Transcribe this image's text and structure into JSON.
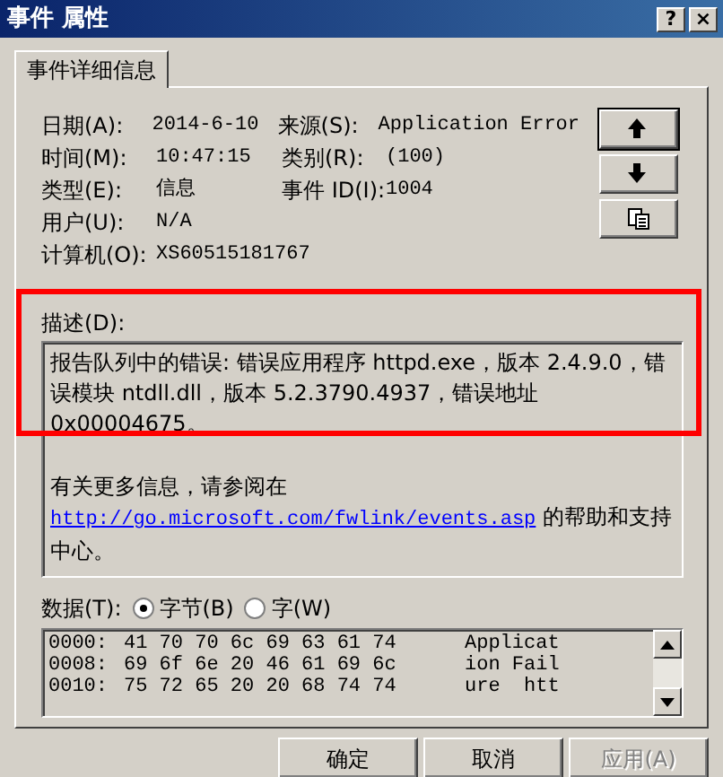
{
  "window": {
    "title": "事件 属性",
    "controls": [
      {
        "kind": "help",
        "label": "?"
      },
      {
        "kind": "close",
        "label": "×"
      }
    ]
  },
  "tabs": [
    {
      "label": "事件详细信息",
      "selected": true
    }
  ],
  "fields": [
    {
      "label": "日期(A):",
      "value": "2014-6-10",
      "label2": "来源(S):",
      "value2": "Application Error"
    },
    {
      "label": "时间(M):",
      "value": "10:47:15",
      "label2": "类别(R):",
      "value2": "(100)"
    },
    {
      "label": "类型(E):",
      "value": "信息",
      "label2": "事件 ID(I):",
      "value2": "1004"
    },
    {
      "label": "用户(U):",
      "value": "N/A"
    },
    {
      "label": "计算机(O):",
      "value": "XS60515181767"
    }
  ],
  "nav_buttons": [
    {
      "kind": "up"
    },
    {
      "kind": "down"
    },
    {
      "kind": "copy"
    }
  ],
  "description": {
    "label": "描述(D):",
    "highlighted": true,
    "text": "报告队列中的错误: 错误应用程序 httpd.exe，版本 2.4.9.0，错误模块 ntdll.dll，版本 5.2.3790.4937，错误地址 0x00004675。",
    "more_before": "有关更多信息，请参阅在",
    "link": "http://go.microsoft.com/fwlink/events.asp",
    "more_after": "的帮助和支持中心。"
  },
  "data": {
    "label": "数据(T):",
    "options": [
      {
        "label": "字节(B)",
        "selected": true
      },
      {
        "label": "字(W)",
        "selected": false
      }
    ],
    "rows": [
      {
        "offset": "0000:",
        "bytes": "41 70 70 6c 69 63 61 74",
        "text": "Applicat"
      },
      {
        "offset": "0008:",
        "bytes": "69 6f 6e 20 46 61 69 6c",
        "text": "ion Fail"
      },
      {
        "offset": "0010:",
        "bytes": "75 72 65 20 20 68 74 74",
        "text": "ure  htt"
      }
    ]
  },
  "buttons": [
    {
      "label": "确定",
      "disabled": false
    },
    {
      "label": "取消",
      "disabled": false
    },
    {
      "label": "应用(A)",
      "disabled": true
    }
  ]
}
